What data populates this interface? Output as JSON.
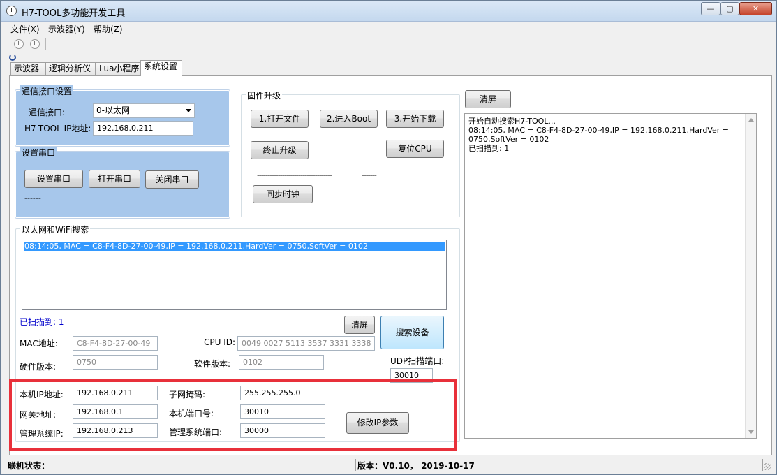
{
  "window": {
    "title": "H7-TOOL多功能开发工具",
    "controls": {
      "minimize": "—",
      "maximize": "▢",
      "close": "✕"
    }
  },
  "menu": [
    "文件(X)",
    "示波器(Y)",
    "帮助(Z)"
  ],
  "tabs": [
    "示波器",
    "逻辑分析仪",
    "Lua小程序",
    "系统设置"
  ],
  "comm": {
    "title": "通信接口设置",
    "interface_label": "通信接口:",
    "interface_value": "0-以太网",
    "ip_label": "H7-TOOL IP地址:",
    "ip_value": "192.168.0.211"
  },
  "serial": {
    "title": "设置串口",
    "setup_btn": "设置串口",
    "open_btn": "打开串口",
    "close_btn": "关闭串口",
    "status": "------"
  },
  "firmware": {
    "title": "固件升级",
    "open_file_btn": "1.打开文件",
    "enter_boot_btn": "2.进入Boot",
    "start_download_btn": "3.开始下载",
    "stop_btn": "终止升级",
    "reset_cpu_btn": "复位CPU",
    "progress_text": "------------------------------------",
    "progress_text2": "-------",
    "sync_clock_btn": "同步时钟"
  },
  "search": {
    "title": "以太网和WiFi搜索",
    "results": [
      "08:14:05, MAC = C8-F4-8D-27-00-49,IP = 192.168.0.211,HardVer = 0750,SoftVer = 0102"
    ],
    "found_label": "已扫描到: 1",
    "clear_btn": "清屏",
    "search_btn": "搜索设备",
    "mac_label": "MAC地址:",
    "mac_value": "C8-F4-8D-27-00-49",
    "cpuid_label": "CPU ID:",
    "cpuid_value": "0049 0027 5113 3537 3331 3338",
    "hw_label": "硬件版本:",
    "hw_value": "0750",
    "sw_label": "软件版本:",
    "sw_value": "0102",
    "udp_label": "UDP扫描端口:",
    "udp_value": "30010"
  },
  "ipconfig": {
    "local_ip_label": "本机IP地址:",
    "local_ip_value": "192.168.0.211",
    "subnet_label": "子网掩码:",
    "subnet_value": "255.255.255.0",
    "gateway_label": "网关地址:",
    "gateway_value": "192.168.0.1",
    "local_port_label": "本机端口号:",
    "local_port_value": "30010",
    "mgr_ip_label": "管理系统IP:",
    "mgr_ip_value": "192.168.0.213",
    "mgr_port_label": "管理系统端口:",
    "mgr_port_value": "30000",
    "modify_btn": "修改IP参数"
  },
  "log": {
    "clear_btn": "清屏",
    "lines": [
      "开始自动搜索H7-TOOL...",
      "08:14:05, MAC = C8-F4-8D-27-00-49,IP = 192.168.0.211,HardVer =",
      "0750,SoftVer = 0102",
      "已扫描到: 1"
    ]
  },
  "status": {
    "conn_label": "联机状态：",
    "version": "版本：V0.10， 2019-10-17"
  },
  "colors": {
    "highlight_border": "#e8303a",
    "group_blue": "#a7c7eb",
    "selection": "#3399ff"
  }
}
